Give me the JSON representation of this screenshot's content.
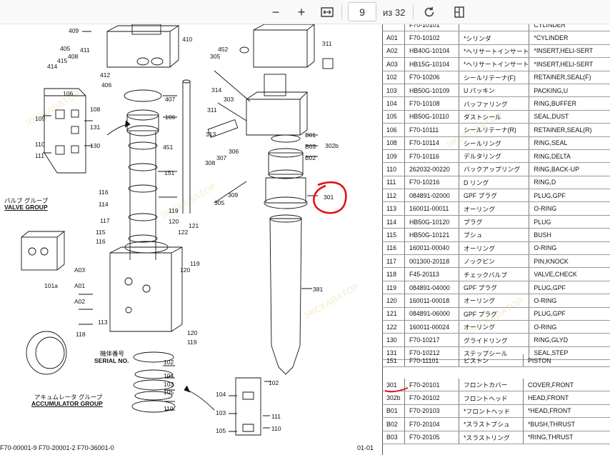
{
  "toolbar": {
    "zoom_out_symbol": "−",
    "zoom_in_symbol": "+",
    "page_current": "9",
    "page_of": "из 32"
  },
  "diagram": {
    "labels_left": [
      "409",
      "405",
      "415",
      "408",
      "411",
      "414",
      "412",
      "406",
      "410",
      "106",
      "108",
      "109",
      "131",
      "130",
      "110",
      "111",
      "116",
      "114",
      "117",
      "115",
      "116",
      "113",
      "118",
      "101a",
      "A03",
      "A01",
      "A02"
    ],
    "labels_center": [
      "407",
      "106",
      "451",
      "151",
      "119",
      "120",
      "121",
      "122",
      "119",
      "120",
      "102",
      "104",
      "103",
      "105",
      "110",
      "120",
      "119"
    ],
    "labels_right": [
      "452",
      "311",
      "305",
      "314",
      "303",
      "311",
      "313",
      "306",
      "308",
      "307",
      "309",
      "305",
      "B01",
      "B03",
      "302b",
      "B02",
      "301",
      "381",
      "102",
      "104",
      "103",
      "105",
      "111",
      "110"
    ],
    "valve_group_jp": "バルブ グループ",
    "valve_group_en": "VALVE GROUP",
    "serial_jp": "機体番号",
    "serial_en": "SERIAL NO.",
    "accumulator_jp": "アキュムレータ グループ",
    "accumulator_en": "ACCUMULATOR GROUP"
  },
  "parts_top": [
    {
      "no": "",
      "code": "F70-10101",
      "jp": "",
      "name": "CYLINDER"
    },
    {
      "no": "A01",
      "code": "F70-10102",
      "jp": "*シリンダ",
      "name": "*CYLINDER"
    },
    {
      "no": "A02",
      "code": "HB40G-10104",
      "jp": "*ヘリサートインサート",
      "name": "*INSERT,HELI-SERT"
    },
    {
      "no": "A03",
      "code": "HB15G-10104",
      "jp": "*ヘリサートインサート",
      "name": "*INSERT,HELI-SERT"
    },
    {
      "no": "102",
      "code": "F70-10206",
      "jp": "シールリテーナ(F)",
      "name": "RETAINER,SEAL(F)"
    },
    {
      "no": "103",
      "code": "HB50G-10109",
      "jp": "U パッキン",
      "name": "PACKING,U"
    },
    {
      "no": "104",
      "code": "F70-10108",
      "jp": "バッファリング",
      "name": "RING,BUFFER"
    },
    {
      "no": "105",
      "code": "HB50G-10110",
      "jp": "ダストシール",
      "name": "SEAL,DUST"
    },
    {
      "no": "106",
      "code": "F70-10111",
      "jp": "シールリテーナ(R)",
      "name": "RETAINER,SEAL(R)"
    },
    {
      "no": "108",
      "code": "F70-10114",
      "jp": "シールリング",
      "name": "RING,SEAL"
    },
    {
      "no": "109",
      "code": "F70-10116",
      "jp": "デルタリング",
      "name": "RING,DELTA"
    },
    {
      "no": "110",
      "code": "262032-00220",
      "jp": "バックアップリング",
      "name": "RING,BACK-UP"
    },
    {
      "no": "111",
      "code": "F70-10216",
      "jp": "D リング",
      "name": "RING,D"
    },
    {
      "no": "112",
      "code": "084891-02000",
      "jp": "GPF プラグ",
      "name": "PLUG,GPF"
    },
    {
      "no": "113",
      "code": "160011-00011",
      "jp": "オーリング",
      "name": "O-RING"
    },
    {
      "no": "114",
      "code": "HB50G-10120",
      "jp": "プラグ",
      "name": "PLUG"
    },
    {
      "no": "115",
      "code": "HB50G-10121",
      "jp": "ブシュ",
      "name": "BUSH"
    },
    {
      "no": "116",
      "code": "160011-00040",
      "jp": "オーリング",
      "name": "O-RING"
    },
    {
      "no": "117",
      "code": "001300-20118",
      "jp": "ノックピン",
      "name": "PIN,KNOCK"
    },
    {
      "no": "118",
      "code": "F45-20113",
      "jp": "チェックバルブ",
      "name": "VALVE,CHECK"
    },
    {
      "no": "119",
      "code": "084891-04000",
      "jp": "GPF プラグ",
      "name": "PLUG,GPF"
    },
    {
      "no": "120",
      "code": "160011-00018",
      "jp": "オーリング",
      "name": "O-RING"
    },
    {
      "no": "121",
      "code": "084891-06000",
      "jp": "GPF プラグ",
      "name": "PLUG,GPF"
    },
    {
      "no": "122",
      "code": "160011-00024",
      "jp": "オーリング",
      "name": "O-RING"
    },
    {
      "no": "130",
      "code": "F70-10217",
      "jp": "グライドリング",
      "name": "RING,GLYD"
    },
    {
      "no": "131",
      "code": "F70-10212",
      "jp": "ステップシール",
      "name": "SEAL,STEP"
    }
  ],
  "parts_mid": [
    {
      "no": "151",
      "code": "F70-11101",
      "jp": "ピストン",
      "name": "PISTON"
    }
  ],
  "parts_bottom": [
    {
      "no": "301",
      "code": "F70-20101",
      "jp": "フロントカバー",
      "name": "COVER,FRONT"
    },
    {
      "no": "302b",
      "code": "F70-20102",
      "jp": "フロントヘッド",
      "name": "HEAD,FRONT"
    },
    {
      "no": "B01",
      "code": "F70-20103",
      "jp": "*フロントヘッド",
      "name": "*HEAD,FRONT"
    },
    {
      "no": "B02",
      "code": "F70-20104",
      "jp": "*スラストブシュ",
      "name": "*BUSH,THRUST"
    },
    {
      "no": "B03",
      "code": "F70-20105",
      "jp": "*スラストリング",
      "name": "*RING,THRUST"
    }
  ],
  "footer": {
    "left": "F70-00001-9  F70-20001-2  F70-36001-0",
    "right": "01-01"
  },
  "colors": {
    "annotation": "#e0141b"
  }
}
